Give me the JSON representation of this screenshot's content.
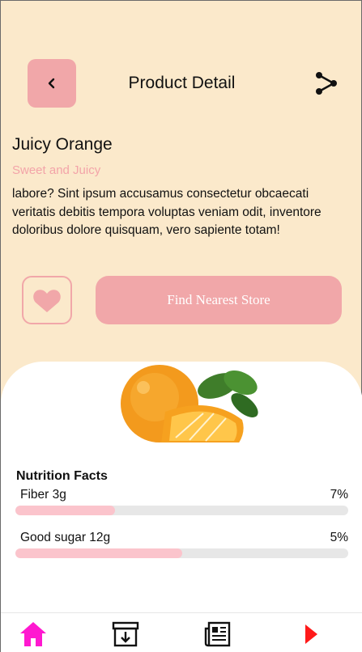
{
  "header": {
    "title": "Product Detail",
    "back_icon": "chevron-left-icon",
    "share_icon": "share-icon"
  },
  "product": {
    "name": "Juicy Orange",
    "tagline": "Sweet and Juicy",
    "description": "labore? Sint ipsum accusamus consectetur obcaecati veritatis debitis tempora voluptas veniam odit, inventore doloribus dolore quisquam, vero sapiente totam!",
    "image": "orange-fruit-image"
  },
  "actions": {
    "favorite_icon": "heart-icon",
    "store_button_label": "Find Nearest Store"
  },
  "nutrition": {
    "title": "Nutrition Facts",
    "items": [
      {
        "label": "Fiber 3g",
        "percent_label": "7%",
        "bar_fraction": 0.3
      },
      {
        "label": "Good sugar 12g",
        "percent_label": "5%",
        "bar_fraction": 0.5
      }
    ]
  },
  "nav": {
    "items": [
      "home-icon",
      "archive-icon",
      "news-icon",
      "play-icon"
    ]
  },
  "colors": {
    "background": "#fbe9cb",
    "accent": "#f1a7a9",
    "bar_fill": "#fbc4cc",
    "home_icon": "#ff18d0",
    "play_icon": "#ff1a1a"
  }
}
